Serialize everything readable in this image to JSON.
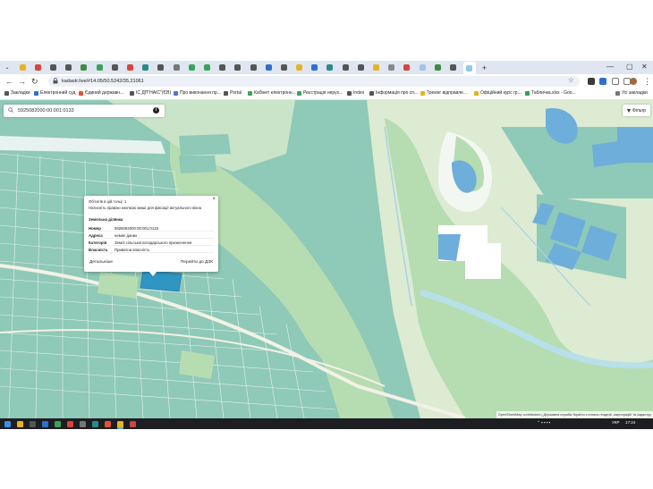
{
  "browser": {
    "url": "kadastr.live/#14.05/50.5242/35.2106‎1",
    "new_tab_label": "+",
    "bookmarks": [
      {
        "label": "Закладки",
        "color": "#555555"
      },
      {
        "label": "Електронний суд",
        "color": "#2f6fcf"
      },
      {
        "label": "Єдиний державн...",
        "color": "#e0532f"
      },
      {
        "label": "ІС ДП\"НАІС\"(ЄВ)",
        "color": "#555555"
      },
      {
        "label": "Про виконання пр...",
        "color": "#4a7bd1"
      },
      {
        "label": "Portal",
        "color": "#555555"
      },
      {
        "label": "Кабінет електронн...",
        "color": "#3aa35a"
      },
      {
        "label": "Реєстрація нерух...",
        "color": "#3aa35a"
      },
      {
        "label": "Index",
        "color": "#555555"
      },
      {
        "label": "Інформація про сп...",
        "color": "#555555"
      },
      {
        "label": "Трекінг відправле...",
        "color": "#e4b21c"
      },
      {
        "label": "Офіційний курс гр...",
        "color": "#e4b21c"
      },
      {
        "label": "Табличка.xlsx - Goo...",
        "color": "#2f9e54"
      }
    ],
    "bookmarks_other": "Усі закладки"
  },
  "map": {
    "search_value": "5925082000:00:001:0133",
    "info_icon": "i",
    "filter_label": "Фільтр",
    "popup": {
      "objects_in_point": "Об'єктів в цій точці: 1",
      "hint": "Натисніть правою кнопкою миші для фіксації актуального вікна",
      "heading": "Земельна ділянка",
      "rows": [
        {
          "key": "Номер",
          "value": "5925082000:00:001:0133"
        },
        {
          "key": "Адреса",
          "value": "немає даних"
        },
        {
          "key": "Категорія",
          "value": "Землі сільськогосподарського призначення"
        },
        {
          "key": "Власність",
          "value": "Приватна власність"
        }
      ],
      "details_label": "Детальніше",
      "dzk_label": "Перейти до ДЗК",
      "close_label": "×"
    },
    "attribution": "OpenStreetMap contributors | Державна служба України з питань геодезії, картографії та кадастру",
    "colors": {
      "parcel_fill": "#8fc9b8",
      "parcel_line": "#e8f2ee",
      "forest": "#b6dcb1",
      "meadow": "#dcebd2",
      "water": "#6eaeda",
      "highlight": "#2f96c4",
      "road": "#f4f1e6"
    }
  },
  "taskbar": {
    "tray_lang": "УКР",
    "tray_time": "17:24"
  }
}
